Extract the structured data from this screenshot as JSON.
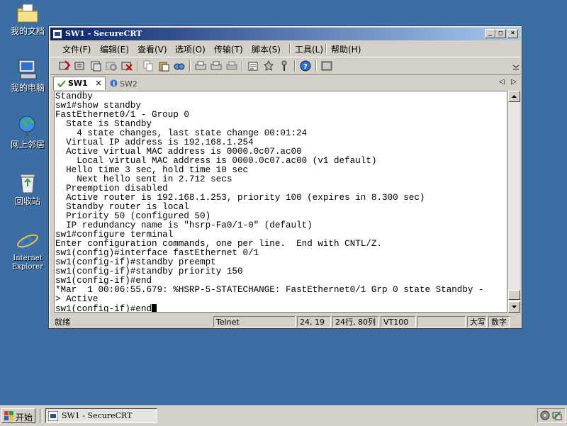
{
  "desktop": {
    "icons": [
      {
        "label": "我的文档"
      },
      {
        "label": "我的电脑"
      },
      {
        "label": "网上邻居"
      },
      {
        "label": "回收站"
      },
      {
        "label_line1": "Internet",
        "label_line2": "Explorer"
      }
    ]
  },
  "window": {
    "title": "SW1 - SecureCRT",
    "controls": {
      "minimize": "_",
      "maximize": "□",
      "close": "×"
    }
  },
  "menu": [
    "文件(F)",
    "编辑(E)",
    "查看(V)",
    "选项(O)",
    "传输(T)",
    "脚本(S)",
    "工具(L)",
    "帮助(H)"
  ],
  "tabs": [
    {
      "label": "SW1",
      "close": "×",
      "status": "connected"
    },
    {
      "label": "SW2",
      "status": "info"
    }
  ],
  "tab_nav": {
    "prev": "◁",
    "next": "▷"
  },
  "terminal": {
    "lines": [
      "Standby",
      "sw1#show standby",
      "FastEthernet0/1 - Group 0",
      "  State is Standby",
      "    4 state changes, last state change 00:01:24",
      "  Virtual IP address is 192.168.1.254",
      "  Active virtual MAC address is 0000.0c07.ac00",
      "    Local virtual MAC address is 0000.0c07.ac00 (v1 default)",
      "  Hello time 3 sec, hold time 10 sec",
      "    Next hello sent in 2.712 secs",
      "  Preemption disabled",
      "  Active router is 192.168.1.253, priority 100 (expires in 8.300 sec)",
      "  Standby router is local",
      "  Priority 50 (configured 50)",
      "  IP redundancy name is \"hsrp-Fa0/1-0\" (default)",
      "sw1#configure terminal",
      "Enter configuration commands, one per line.  End with CNTL/Z.",
      "sw1(config)#interface fastEthernet 0/1",
      "sw1(config-if)#standby preempt",
      "sw1(config-if)#standby priority 150",
      "sw1(config-if)#end",
      "*Mar  1 00:06:55.679: %HSRP-5-STATECHANGE: FastEthernet0/1 Grp 0 state Standby -",
      "> Active",
      "sw1(config-if)#end"
    ]
  },
  "status": {
    "ready": "就绪",
    "protocol": "Telnet",
    "cursor_pos": "24, 19",
    "size": "24行, 80列",
    "emulation": "VT100",
    "blank": "",
    "caps": "大写",
    "num": "数字"
  },
  "taskbar": {
    "start": "开始",
    "task": "SW1 - SecureCRT"
  },
  "colors": {
    "desktop": "#3a6ea5",
    "titlebar_start": "#0a246a",
    "titlebar_end": "#a6caf0",
    "chrome": "#d4d0c8"
  }
}
